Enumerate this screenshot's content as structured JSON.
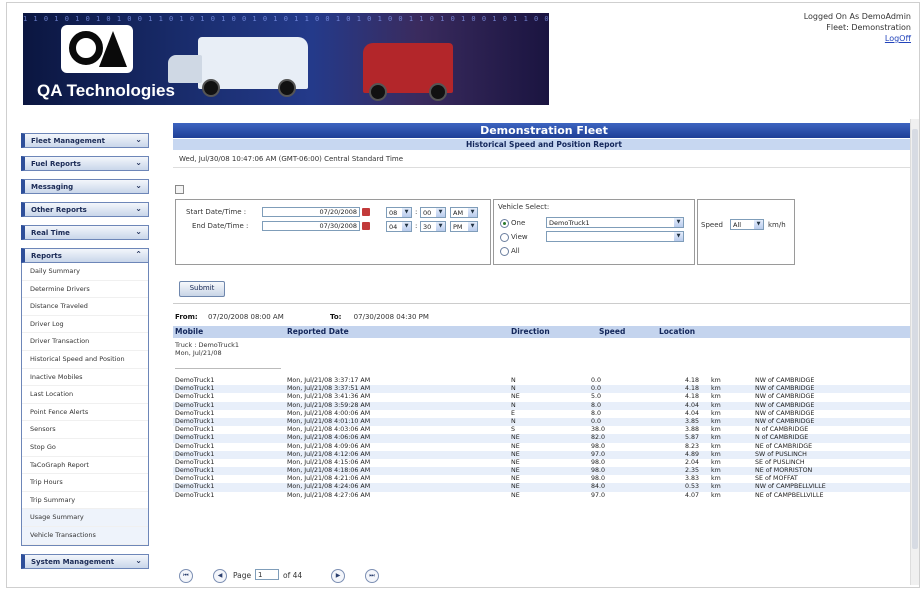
{
  "header": {
    "banner_code": "1 1 0 1 0 1 0 1 0 1 0 0 1 1 0 1 0 1 0 1 0 0 1 0 1 0 1 1 0 0 1 0 1 0 1 0 0 1 1 0 1 0 1 0 0 1 0 1 1 0 0 1 0 1 0",
    "logo_text": "QA Technologies",
    "logged_on": "Logged On As DemoAdmin",
    "fleet": "Fleet: Demonstration",
    "logoff": "LogOff"
  },
  "sidebar": {
    "sections": {
      "fleet_management": "Fleet Management",
      "fuel_reports": "Fuel Reports",
      "messaging": "Messaging",
      "other_reports": "Other Reports",
      "real_time": "Real Time",
      "reports": "Reports",
      "system_management": "System Management"
    },
    "report_items": [
      "Daily Summary",
      "Determine Drivers",
      "Distance Traveled",
      "Driver Log",
      "Driver Transaction",
      "Historical Speed and Position",
      "Inactive Mobiles",
      "Last Location",
      "Point Fence Alerts",
      "Sensors",
      "Stop Go",
      "TaCoGraph Report",
      "Trip Hours",
      "Trip Summary",
      "Usage Summary",
      "Vehicle Transactions"
    ]
  },
  "main": {
    "fleet_title": "Demonstration Fleet",
    "report_title": "Historical Speed and Position Report",
    "datetime": "Wed, Jul/30/08 10:47:06 AM  (GMT-06:00) Central Standard Time",
    "form": {
      "start_label": "Start Date/Time :",
      "end_label": "End Date/Time :",
      "start_date": "07/20/2008",
      "end_date": "07/30/2008",
      "start_hour": "08",
      "start_min": "00",
      "start_ampm": "AM",
      "end_hour": "04",
      "end_min": "30",
      "end_ampm": "PM",
      "colon": ":",
      "vehicle_select_label": "Vehicle Select:",
      "opt_one": "One",
      "opt_view": "View",
      "opt_all": "All",
      "vehicle_value": "DemoTruck1",
      "view_value": "",
      "speed_label": "Speed",
      "speed_value": "All",
      "speed_unit": "km/h",
      "submit": "Submit"
    },
    "from_label": "From:",
    "from_value": "07/20/2008 08:00 AM",
    "to_label": "To:",
    "to_value": "07/30/2008 04:30 PM",
    "columns": {
      "mobile": "Mobile",
      "date": "Reported Date",
      "direction": "Direction",
      "speed": "Speed",
      "location": "Location"
    },
    "group_truck": "Truck : DemoTruck1",
    "group_date": "Mon, Jul/21/08",
    "rows": [
      {
        "mobile": "DemoTruck1",
        "date": "Mon, Jul/21/08 3:37:17 AM",
        "dir": "N",
        "speed": "0.0",
        "dist": "4.18",
        "unit": "km",
        "loc": "NW of CAMBRIDGE"
      },
      {
        "mobile": "DemoTruck1",
        "date": "Mon, Jul/21/08 3:37:51 AM",
        "dir": "N",
        "speed": "0.0",
        "dist": "4.18",
        "unit": "km",
        "loc": "NW of CAMBRIDGE"
      },
      {
        "mobile": "DemoTruck1",
        "date": "Mon, Jul/21/08 3:41:36 AM",
        "dir": "NE",
        "speed": "5.0",
        "dist": "4.18",
        "unit": "km",
        "loc": "NW of CAMBRIDGE"
      },
      {
        "mobile": "DemoTruck1",
        "date": "Mon, Jul/21/08 3:59:28 AM",
        "dir": "N",
        "speed": "8.0",
        "dist": "4.04",
        "unit": "km",
        "loc": "NW of CAMBRIDGE"
      },
      {
        "mobile": "DemoTruck1",
        "date": "Mon, Jul/21/08 4:00:06 AM",
        "dir": "E",
        "speed": "8.0",
        "dist": "4.04",
        "unit": "km",
        "loc": "NW of CAMBRIDGE"
      },
      {
        "mobile": "DemoTruck1",
        "date": "Mon, Jul/21/08 4:01:10 AM",
        "dir": "N",
        "speed": "0.0",
        "dist": "3.85",
        "unit": "km",
        "loc": "NW of CAMBRIDGE"
      },
      {
        "mobile": "DemoTruck1",
        "date": "Mon, Jul/21/08 4:03:06 AM",
        "dir": "S",
        "speed": "38.0",
        "dist": "3.88",
        "unit": "km",
        "loc": "N of CAMBRIDGE"
      },
      {
        "mobile": "DemoTruck1",
        "date": "Mon, Jul/21/08 4:06:06 AM",
        "dir": "NE",
        "speed": "82.0",
        "dist": "5.87",
        "unit": "km",
        "loc": "N of CAMBRIDGE"
      },
      {
        "mobile": "DemoTruck1",
        "date": "Mon, Jul/21/08 4:09:06 AM",
        "dir": "NE",
        "speed": "98.0",
        "dist": "8.23",
        "unit": "km",
        "loc": "NE of CAMBRIDGE"
      },
      {
        "mobile": "DemoTruck1",
        "date": "Mon, Jul/21/08 4:12:06 AM",
        "dir": "NE",
        "speed": "97.0",
        "dist": "4.89",
        "unit": "km",
        "loc": "SW of PUSLINCH"
      },
      {
        "mobile": "DemoTruck1",
        "date": "Mon, Jul/21/08 4:15:06 AM",
        "dir": "NE",
        "speed": "98.0",
        "dist": "2.04",
        "unit": "km",
        "loc": "SE of PUSLINCH"
      },
      {
        "mobile": "DemoTruck1",
        "date": "Mon, Jul/21/08 4:18:06 AM",
        "dir": "NE",
        "speed": "98.0",
        "dist": "2.35",
        "unit": "km",
        "loc": "NE of MORRISTON"
      },
      {
        "mobile": "DemoTruck1",
        "date": "Mon, Jul/21/08 4:21:06 AM",
        "dir": "NE",
        "speed": "98.0",
        "dist": "3.83",
        "unit": "km",
        "loc": "SE of MOFFAT"
      },
      {
        "mobile": "DemoTruck1",
        "date": "Mon, Jul/21/08 4:24:06 AM",
        "dir": "NE",
        "speed": "84.0",
        "dist": "0.53",
        "unit": "km",
        "loc": "NW of CAMPBELLVILLE"
      },
      {
        "mobile": "DemoTruck1",
        "date": "Mon, Jul/21/08 4:27:06 AM",
        "dir": "NE",
        "speed": "97.0",
        "dist": "4.07",
        "unit": "km",
        "loc": "NE of CAMPBELLVILLE"
      }
    ],
    "pager": {
      "page_label": "Page",
      "page_value": "1",
      "of_label": "of 44"
    }
  }
}
